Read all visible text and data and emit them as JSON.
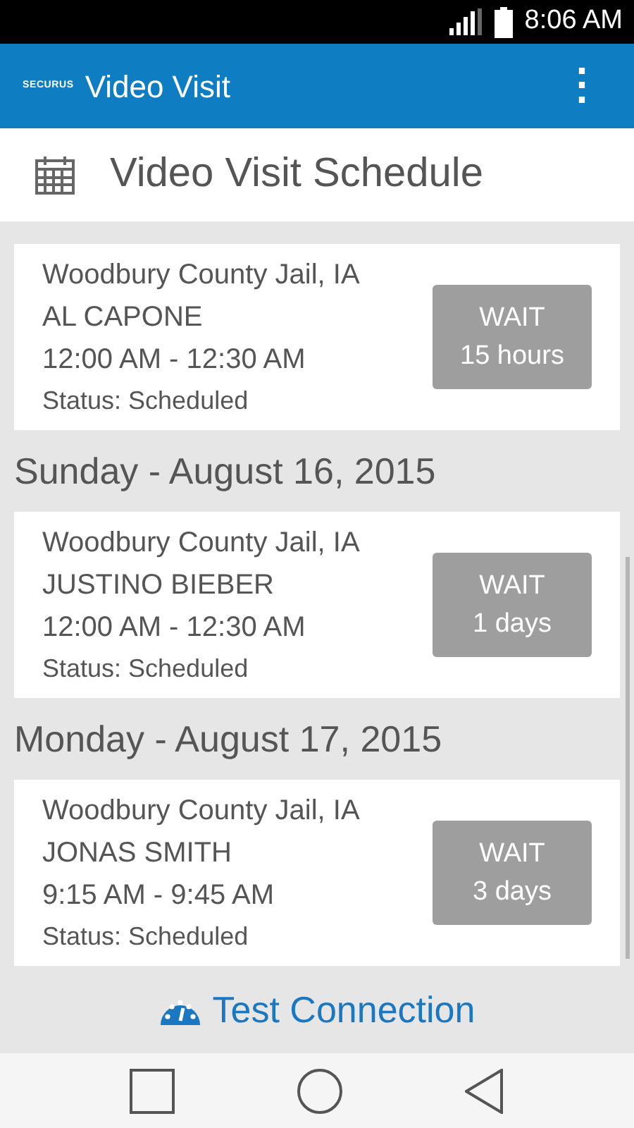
{
  "status_bar": {
    "time": "8:06 AM"
  },
  "app_bar": {
    "logo": "SECURUS",
    "title": "Video Visit",
    "menu": "⋮"
  },
  "header": {
    "title": "Video Visit Schedule"
  },
  "schedule": [
    {
      "kind": "visit",
      "facility": "Woodbury County Jail, IA",
      "inmate": "AL CAPONE",
      "time": "12:00 AM - 12:30 AM",
      "status": "Status: Scheduled",
      "button": {
        "label": "WAIT",
        "sub": "15 hours"
      }
    },
    {
      "kind": "date",
      "label": "Sunday - August 16, 2015"
    },
    {
      "kind": "visit",
      "facility": "Woodbury County Jail, IA",
      "inmate": "JUSTINO BIEBER",
      "time": "12:00 AM - 12:30 AM",
      "status": "Status: Scheduled",
      "button": {
        "label": "WAIT",
        "sub": "1 days"
      }
    },
    {
      "kind": "date",
      "label": "Monday - August 17, 2015"
    },
    {
      "kind": "visit",
      "facility": "Woodbury County Jail, IA",
      "inmate": "JONAS SMITH",
      "time": "9:15 AM - 9:45 AM",
      "status": "Status: Scheduled",
      "button": {
        "label": "WAIT",
        "sub": "3 days"
      }
    }
  ],
  "footer": {
    "link": "Test Connection"
  }
}
